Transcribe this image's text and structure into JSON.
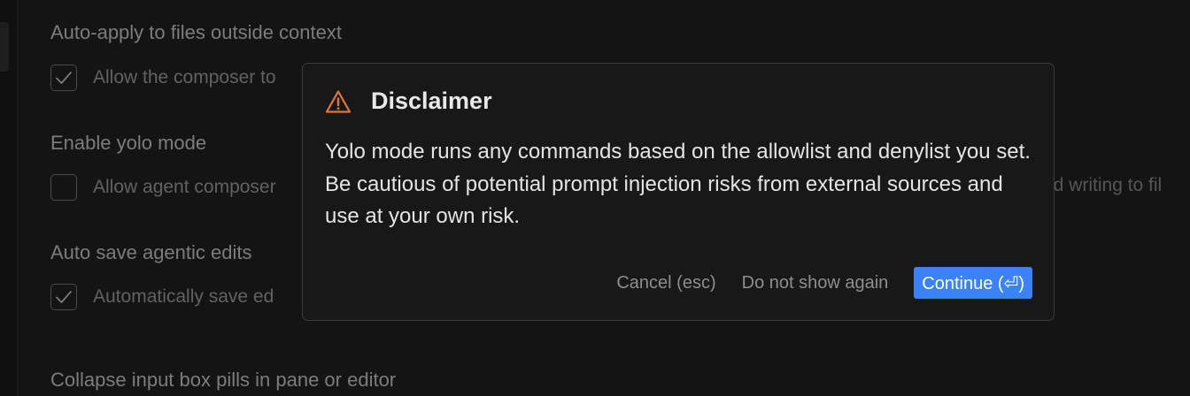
{
  "settings": {
    "items": [
      {
        "title": "Auto-apply to files outside context",
        "description": "Allow the composer to",
        "checked": true
      },
      {
        "title": "Enable yolo mode",
        "description": "Allow agent composer",
        "overflow_text": "nd writing to fil",
        "checked": false
      },
      {
        "title": "Auto save agentic edits",
        "description": "Automatically save ed",
        "checked": true
      },
      {
        "title": "Collapse input box pills in pane or editor"
      }
    ]
  },
  "dialog": {
    "icon": "warning-icon",
    "icon_color": "#e0773a",
    "title": "Disclaimer",
    "body": "Yolo mode runs any commands based on the allowlist and denylist you set. Be cautious of potential prompt injection risks from external sources and use at your own risk.",
    "buttons": {
      "cancel": "Cancel (esc)",
      "dont_show": "Do not show again",
      "continue": "Continue (⏎)"
    }
  },
  "colors": {
    "accent": "#3b82f6",
    "background": "#141414",
    "dialog_background": "#181818"
  }
}
